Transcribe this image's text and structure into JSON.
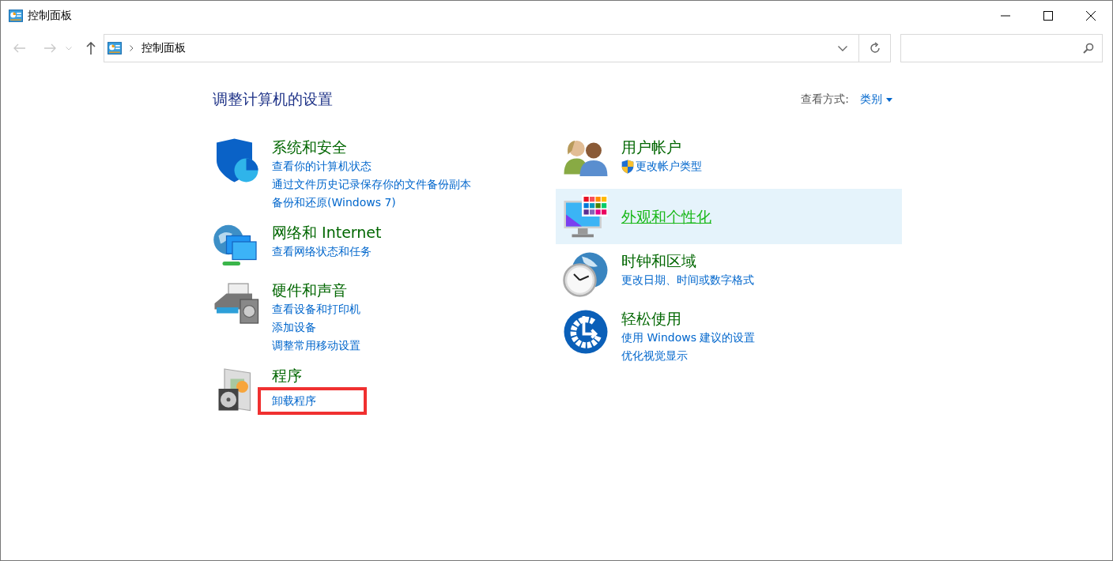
{
  "window": {
    "title": "控制面板"
  },
  "address_bar": {
    "path": "控制面板"
  },
  "heading": "调整计算机的设置",
  "view_by": {
    "label": "查看方式:",
    "value": "类别"
  },
  "left_categories": [
    {
      "title": "系统和安全",
      "links": [
        {
          "text": "查看你的计算机状态",
          "highlighted": false
        },
        {
          "text": "通过文件历史记录保存你的文件备份副本",
          "highlighted": false
        },
        {
          "text": "备份和还原(Windows 7)",
          "highlighted": false
        }
      ]
    },
    {
      "title": "网络和 Internet",
      "links": [
        {
          "text": "查看网络状态和任务",
          "highlighted": false
        }
      ]
    },
    {
      "title": "硬件和声音",
      "links": [
        {
          "text": "查看设备和打印机",
          "highlighted": false
        },
        {
          "text": "添加设备",
          "highlighted": false
        },
        {
          "text": "调整常用移动设置",
          "highlighted": false
        }
      ]
    },
    {
      "title": "程序",
      "links": [
        {
          "text": "卸载程序",
          "highlighted": true
        }
      ]
    }
  ],
  "right_categories": [
    {
      "title": "用户帐户",
      "hovered": false,
      "links": [
        {
          "kind": "shield",
          "text": "更改帐户类型",
          "highlighted": false
        }
      ]
    },
    {
      "title": "外观和个性化",
      "hovered": true
    },
    {
      "title": "时钟和区域",
      "hovered": false,
      "links": [
        {
          "kind": "plain",
          "text": "更改日期、时间或数字格式",
          "highlighted": false
        }
      ]
    },
    {
      "title": "轻松使用",
      "hovered": false,
      "links": [
        {
          "kind": "plain",
          "text": "使用 Windows 建议的设置",
          "highlighted": false
        },
        {
          "kind": "plain",
          "text": "优化视觉显示",
          "highlighted": false
        }
      ]
    }
  ]
}
